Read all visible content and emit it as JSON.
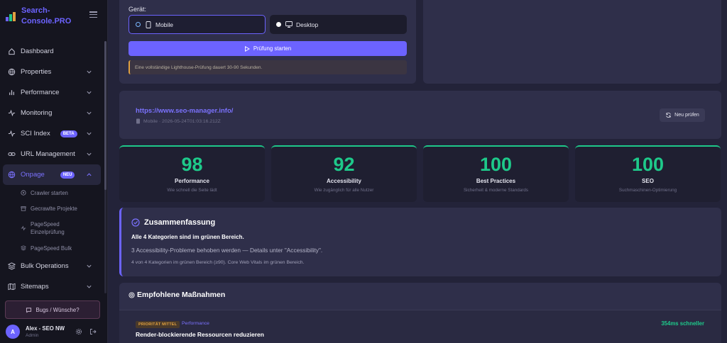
{
  "brand": {
    "name_line1": "Search-",
    "name_line2": "Console.PRO"
  },
  "sidebar": {
    "items": [
      {
        "label": "Dashboard",
        "icon": "home-icon"
      },
      {
        "label": "Properties",
        "icon": "globe-icon"
      },
      {
        "label": "Performance",
        "icon": "bar-chart-icon"
      },
      {
        "label": "Monitoring",
        "icon": "activity-icon"
      },
      {
        "label": "SCI Index",
        "icon": "activity-icon",
        "badge": "BETA"
      },
      {
        "label": "URL Management",
        "icon": "link-icon"
      },
      {
        "label": "Onpage",
        "icon": "globe-icon",
        "badge": "NEU"
      },
      {
        "label": "Bulk Operations",
        "icon": "layers-icon"
      },
      {
        "label": "Sitemaps",
        "icon": "map-icon"
      }
    ],
    "subitems": [
      {
        "label": "Crawler starten",
        "icon": "play-circle-icon"
      },
      {
        "label": "Gecrawlte Projekte",
        "icon": "archive-icon"
      },
      {
        "label": "PageSpeed Einzelprüfung",
        "icon": "activity-icon"
      },
      {
        "label": "PageSpeed Bulk",
        "icon": "layers-icon"
      }
    ],
    "bugs_button": "Bugs / Wünsche?"
  },
  "user": {
    "initial": "A",
    "name": "Alex - SEO NW",
    "role": "Admin"
  },
  "device": {
    "label": "Gerät:",
    "mobile": "Mobile",
    "desktop": "Desktop",
    "selected": "Mobile",
    "start_button": "Prüfung starten",
    "hint": "Eine vollständige Lighthouse-Prüfung dauert 30-90 Sekunden."
  },
  "result": {
    "url": "https://www.seo-manager.info/",
    "meta": "Mobile · 2026-05-24T01:03:16.212Z",
    "recheck_button": "Neu prüfen"
  },
  "scores": [
    {
      "value": "98",
      "title": "Performance",
      "subtitle": "Wie schnell die Seite lädt"
    },
    {
      "value": "92",
      "title": "Accessibility",
      "subtitle": "Wie zugänglich für alle Nutzer"
    },
    {
      "value": "100",
      "title": "Best Practices",
      "subtitle": "Sicherheit & moderne Standards"
    },
    {
      "value": "100",
      "title": "SEO",
      "subtitle": "Suchmaschinen-Optimierung"
    }
  ],
  "summary": {
    "title": "Zusammenfassung",
    "line1": "Alle 4 Kategorien sind im grünen Bereich.",
    "line2": "3 Accessibility-Probleme behoben werden — Details unter \"Accessibility\".",
    "line3": "4 von 4 Kategorien im grünen Bereich (≥90). Core Web Vitals im grünen Bereich."
  },
  "actions": {
    "title": "Empfohlene Maßnahmen",
    "items": [
      {
        "priority": "PRIORITÄT MITTEL",
        "category": "Performance",
        "gain": "354ms schneller",
        "title": "Render-blockierende Ressourcen reduzieren"
      }
    ]
  },
  "colors": {
    "accent": "#6c63ff",
    "success": "#1ec98a",
    "warning": "#e0a040"
  }
}
